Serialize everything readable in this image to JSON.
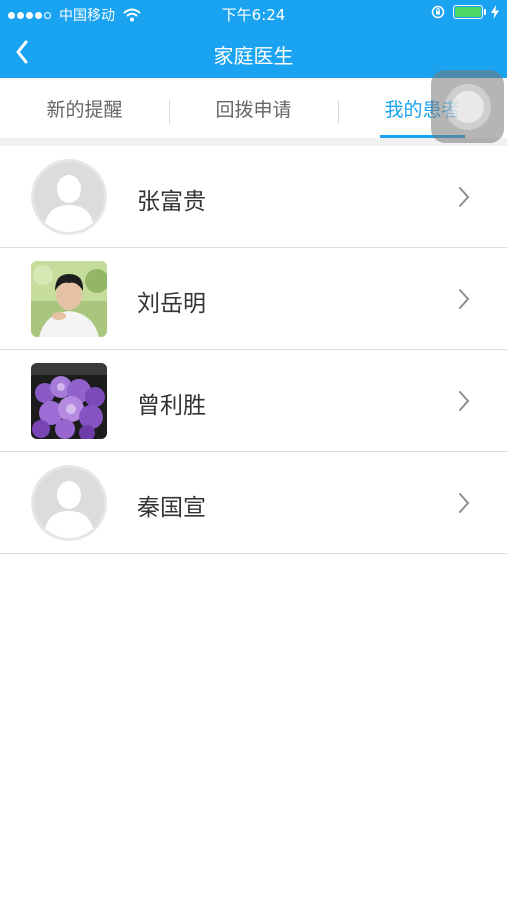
{
  "status_bar": {
    "carrier": "中国移动",
    "time": "下午6:24"
  },
  "nav": {
    "title": "家庭医生"
  },
  "tabs": [
    {
      "label": "新的提醒",
      "active": false
    },
    {
      "label": "回拨申请",
      "active": false
    },
    {
      "label": "我的患者",
      "active": true
    }
  ],
  "patients": [
    {
      "name": "张富贵",
      "avatar": "default-avatar"
    },
    {
      "name": "刘岳明",
      "avatar": "photo-young-man"
    },
    {
      "name": "曾利胜",
      "avatar": "photo-purple-flowers"
    },
    {
      "name": "秦国宣",
      "avatar": "default-avatar"
    }
  ],
  "colors": {
    "accent": "#1aa3f0",
    "text": "#333333",
    "divider": "#dedede"
  }
}
